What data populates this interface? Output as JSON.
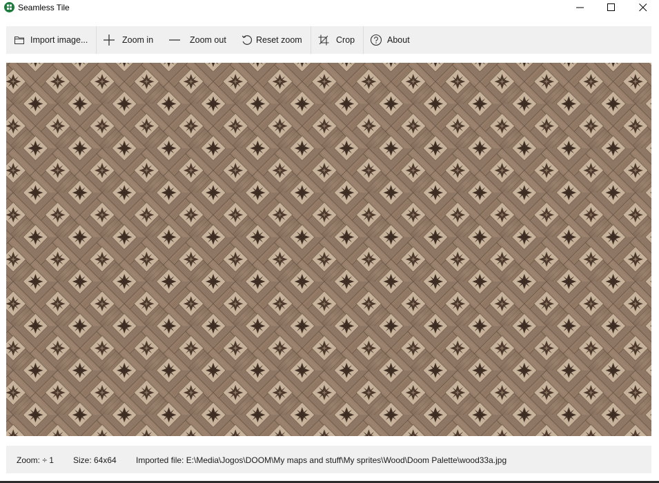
{
  "window": {
    "title": "Seamless Tile",
    "app_icon": "seamless-tile-app-icon",
    "controls": [
      "minimize-icon",
      "maximize-icon",
      "close-icon"
    ]
  },
  "toolbar": {
    "import_label": "Import image...",
    "zoom_in_label": "Zoom in",
    "zoom_out_label": "Zoom out",
    "reset_zoom_label": "Reset zoom",
    "crop_label": "Crop",
    "about_label": "About",
    "icons": {
      "import": "folder-icon",
      "zoom_in": "plus-icon",
      "zoom_out": "minus-icon",
      "reset_zoom": "undo-arrow-icon",
      "crop": "crop-icon",
      "about": "question-circle-icon"
    }
  },
  "canvas": {
    "content": "tiled-image-preview"
  },
  "status": {
    "zoom": "Zoom: ÷ 1",
    "size": "Size: 64x64",
    "imported_file": "Imported file: E:\\Media\\Jogos\\DOOM\\My maps and stuff\\My sprites\\Wood\\Doom Palette\\wood33a.jpg"
  },
  "colors": {
    "toolbar_bg": "#f0f0f0",
    "statusbar_bg": "#f0f0f0",
    "app_icon": "#1f7a3d",
    "wood_light": "#c8b39c",
    "wood_mid": "#9a8270",
    "wood_dark": "#5b4636",
    "star_dark": "#3e2d22"
  }
}
